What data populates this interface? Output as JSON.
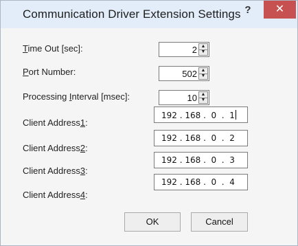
{
  "window": {
    "title": "Communication Driver Extension Settings",
    "help_label": "?",
    "close_label": "✕"
  },
  "fields": {
    "timeout": {
      "prefix": "",
      "mnemonic": "T",
      "suffix": "ime Out [sec]:",
      "value": "2"
    },
    "port": {
      "prefix": "",
      "mnemonic": "P",
      "suffix": "ort Number:",
      "value": "502"
    },
    "interval": {
      "prefix": "Processing ",
      "mnemonic": "I",
      "suffix": "nterval [msec]:",
      "value": "10"
    }
  },
  "clients": [
    {
      "prefix": "Client Address",
      "mnemonic": "1",
      "suffix": ":",
      "value": "192 . 168 .  0  .  1"
    },
    {
      "prefix": "Client Address",
      "mnemonic": "2",
      "suffix": ":",
      "value": "192 . 168 .  0  .  2"
    },
    {
      "prefix": "Client Address",
      "mnemonic": "3",
      "suffix": ":",
      "value": "192 . 168 .  0  .  3"
    },
    {
      "prefix": "Client Address",
      "mnemonic": "4",
      "suffix": ":",
      "value": "192 . 168 .  0  .  4"
    }
  ],
  "buttons": {
    "ok": "OK",
    "cancel": "Cancel"
  },
  "icons": {
    "spin_up": "▲",
    "spin_down": "▼"
  },
  "colors": {
    "titlebar": "#e2edf9",
    "close": "#c75050"
  }
}
